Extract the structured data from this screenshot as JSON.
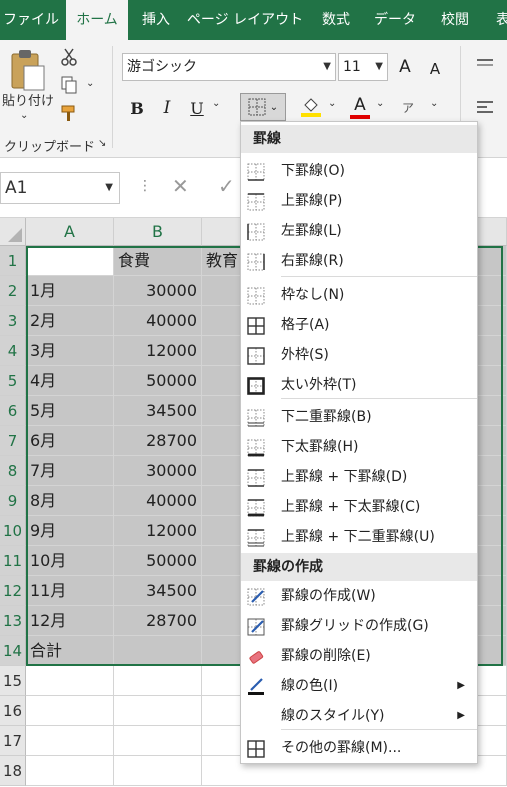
{
  "tabs": [
    "ファイル",
    "ホーム",
    "挿入",
    "ページ レイアウト",
    "数式",
    "データ",
    "校閲",
    "表"
  ],
  "ribbon": {
    "paste_label": "貼り付け",
    "clipboard_group": "クリップボード",
    "font_name": "游ゴシック",
    "font_size": "11",
    "grow_font": "A",
    "shrink_font": "A",
    "bold": "B",
    "italic": "I",
    "underline": "U",
    "font_color_letter": "A",
    "fill_color": "#ffe000",
    "font_color": "#e00000"
  },
  "formula_bar": {
    "name_box": "A1"
  },
  "grid": {
    "columns": [
      "A",
      "B"
    ],
    "row_numbers": [
      "1",
      "2",
      "3",
      "4",
      "5",
      "6",
      "7",
      "8",
      "9",
      "10",
      "11",
      "12",
      "13",
      "14",
      "15",
      "16",
      "17",
      "18"
    ],
    "rows": [
      {
        "a": "",
        "b": "食費",
        "c": "教育"
      },
      {
        "a": "1月",
        "b": "30000",
        "c": ""
      },
      {
        "a": "2月",
        "b": "40000",
        "c": ""
      },
      {
        "a": "3月",
        "b": "12000",
        "c": ""
      },
      {
        "a": "4月",
        "b": "50000",
        "c": ""
      },
      {
        "a": "5月",
        "b": "34500",
        "c": ""
      },
      {
        "a": "6月",
        "b": "28700",
        "c": ""
      },
      {
        "a": "7月",
        "b": "30000",
        "c": ""
      },
      {
        "a": "8月",
        "b": "40000",
        "c": ""
      },
      {
        "a": "9月",
        "b": "12000",
        "c": ""
      },
      {
        "a": "10月",
        "b": "50000",
        "c": ""
      },
      {
        "a": "11月",
        "b": "34500",
        "c": ""
      },
      {
        "a": "12月",
        "b": "28700",
        "c": ""
      },
      {
        "a": "合計",
        "b": "",
        "c": ""
      }
    ]
  },
  "menu": {
    "section1": "罫線",
    "items1": [
      {
        "label": "下罫線(O)",
        "icon": "bottom-border-icon"
      },
      {
        "label": "上罫線(P)",
        "icon": "top-border-icon"
      },
      {
        "label": "左罫線(L)",
        "icon": "left-border-icon"
      },
      {
        "label": "右罫線(R)",
        "icon": "right-border-icon"
      },
      {
        "label": "枠なし(N)",
        "icon": "no-border-icon"
      },
      {
        "label": "格子(A)",
        "icon": "all-borders-icon"
      },
      {
        "label": "外枠(S)",
        "icon": "outside-borders-icon"
      },
      {
        "label": "太い外枠(T)",
        "icon": "thick-outside-borders-icon"
      },
      {
        "label": "下二重罫線(B)",
        "icon": "bottom-double-border-icon"
      },
      {
        "label": "下太罫線(H)",
        "icon": "thick-bottom-border-icon"
      },
      {
        "label": "上罫線 + 下罫線(D)",
        "icon": "top-and-bottom-border-icon"
      },
      {
        "label": "上罫線 + 下太罫線(C)",
        "icon": "top-and-thick-bottom-border-icon"
      },
      {
        "label": "上罫線 + 下二重罫線(U)",
        "icon": "top-and-double-bottom-border-icon"
      }
    ],
    "section2": "罫線の作成",
    "items2": [
      {
        "label": "罫線の作成(W)",
        "icon": "draw-border-icon"
      },
      {
        "label": "罫線グリッドの作成(G)",
        "icon": "draw-border-grid-icon"
      },
      {
        "label": "罫線の削除(E)",
        "icon": "erase-border-icon"
      },
      {
        "label": "線の色(I)",
        "icon": "line-color-icon"
      },
      {
        "label": "線のスタイル(Y)",
        "icon": "line-style-icon"
      },
      {
        "label": "その他の罫線(M)...",
        "icon": "more-borders-icon"
      }
    ]
  }
}
